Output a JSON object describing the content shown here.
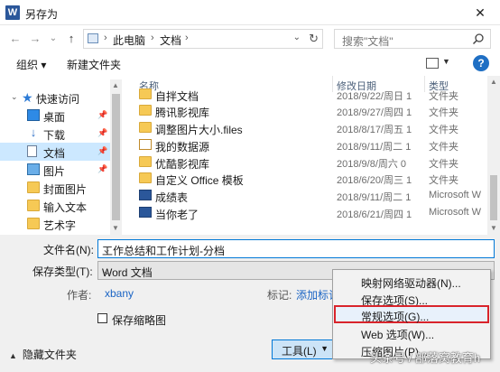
{
  "window": {
    "title": "另存为",
    "close_glyph": "✕"
  },
  "nav": {
    "back": "←",
    "forward": "→",
    "recent": "⌄",
    "up": "↑",
    "breadcrumb": [
      "此电脑",
      "文档"
    ],
    "search_placeholder": "搜索\"文档\""
  },
  "toolbar": {
    "organize": "组织 ▾",
    "new_folder": "新建文件夹",
    "help": "?"
  },
  "sidebar": {
    "items": [
      {
        "label": "快速访问",
        "icon": "star-icon"
      },
      {
        "label": "桌面",
        "icon": "desktop-icon",
        "pinned": true
      },
      {
        "label": "下载",
        "icon": "download-icon",
        "pinned": true
      },
      {
        "label": "文档",
        "icon": "document-icon",
        "pinned": true,
        "selected": true
      },
      {
        "label": "图片",
        "icon": "pictures-icon",
        "pinned": true
      },
      {
        "label": "封面图片",
        "icon": "folder-icon"
      },
      {
        "label": "输入文本",
        "icon": "folder-icon"
      },
      {
        "label": "艺术字",
        "icon": "folder-icon"
      }
    ]
  },
  "files": {
    "columns": {
      "name": "名称",
      "date": "修改日期",
      "type": "类型"
    },
    "rows": [
      {
        "name": "自拌文档",
        "date": "2018/9/22/周日 1",
        "type": "文件夹",
        "icon": "folder-icon"
      },
      {
        "name": "腾讯影视库",
        "date": "2018/9/27/周四 1",
        "type": "文件夹",
        "icon": "folder-icon"
      },
      {
        "name": "调整图片大小.files",
        "date": "2018/8/17/周五 1",
        "type": "文件夹",
        "icon": "folder-icon"
      },
      {
        "name": "我的数据源",
        "date": "2018/9/11/周二 1",
        "type": "文件夹",
        "icon": "database-icon"
      },
      {
        "name": "优酷影视库",
        "date": "2018/9/8/周六 0",
        "type": "文件夹",
        "icon": "folder-icon"
      },
      {
        "name": "自定义 Office 模板",
        "date": "2018/6/20/周三 1",
        "type": "文件夹",
        "icon": "folder-icon"
      },
      {
        "name": "成绩表",
        "date": "2018/9/11/周二 1",
        "type": "Microsoft W",
        "icon": "word-icon"
      },
      {
        "name": "当你老了",
        "date": "2018/6/21/周四 1",
        "type": "Microsoft W",
        "icon": "word-icon"
      }
    ]
  },
  "form": {
    "filename_label": "文件名(N):",
    "filename_value": "工作总结和工作计划-分档",
    "filetype_label": "保存类型(T):",
    "filetype_value": "Word 文档",
    "author_label": "作者:",
    "author_value": "xbany",
    "tags_label": "标记:",
    "tags_value": "添加标记",
    "thumbnail_label": "保存缩略图",
    "hide_folders": "隐藏文件夹",
    "tools_button": "工具(L)"
  },
  "tools_menu": {
    "items": [
      {
        "label": "映射网络驱动器(N)..."
      },
      {
        "label": "保存选项(S)..."
      },
      {
        "label": "常规选项(G)...",
        "highlighted": true
      },
      {
        "label": "Web 选项(W)..."
      },
      {
        "label": "压缩图片(P)..."
      }
    ]
  },
  "watermark": "头条号 / 部落窝教育h",
  "colors": {
    "accent": "#0078d7",
    "highlight_border": "#d9242b",
    "selection": "#cce8ff",
    "folder": "#f6c955",
    "word": "#2b579a"
  }
}
